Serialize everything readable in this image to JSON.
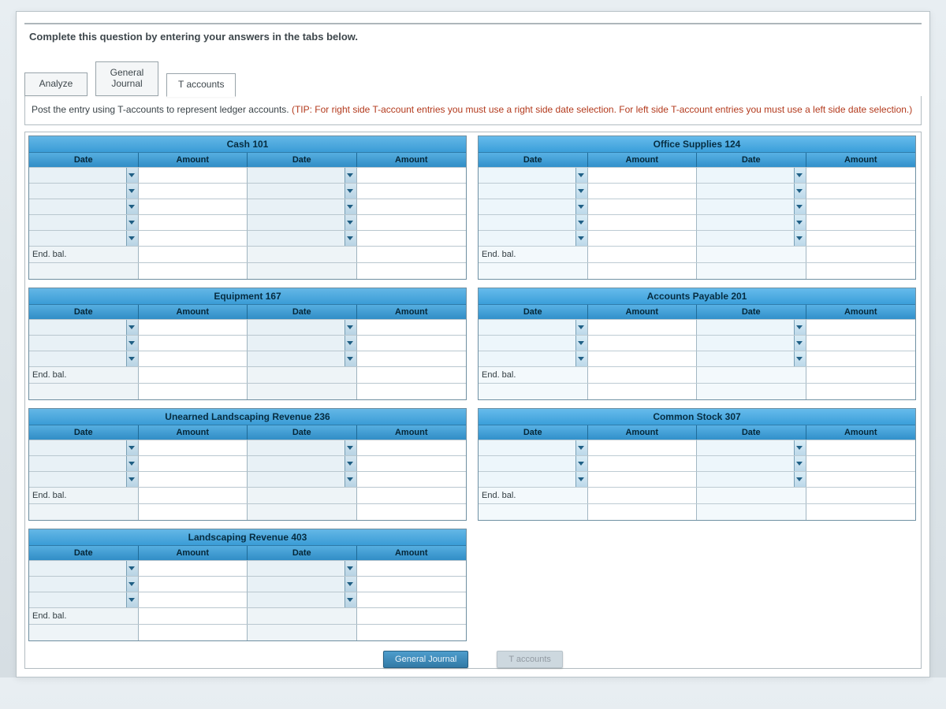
{
  "instruction": "Complete this question by entering your answers in the tabs below.",
  "tabs": [
    {
      "label": "Analyze",
      "active": false
    },
    {
      "label": "General\nJournal",
      "active": false
    },
    {
      "label": "T accounts",
      "active": true
    }
  ],
  "tip": {
    "lead": "Post the entry using T-accounts to represent ledger accounts. ",
    "paren": "(TIP: For right side T-account entries you must use a right side date selection.  For left side T-account entries you must use a left side date selection.)"
  },
  "headers": {
    "date_l": "Date",
    "amount_l": "Amount",
    "date_r": "Date",
    "amount_r": "Amount"
  },
  "end_bal_label": "End. bal.",
  "chart_data": {
    "type": "table",
    "title": "T-accounts (blank worksheet)",
    "accounts": [
      {
        "title": "Cash 101",
        "rows": 5,
        "col": "left"
      },
      {
        "title": "Equipment 167",
        "rows": 3,
        "col": "left"
      },
      {
        "title": "Unearned Landscaping Revenue 236",
        "rows": 3,
        "col": "left"
      },
      {
        "title": "Landscaping Revenue 403",
        "rows": 3,
        "col": "left"
      },
      {
        "title": "Office Supplies 124",
        "rows": 5,
        "col": "right"
      },
      {
        "title": "Accounts Payable 201",
        "rows": 3,
        "col": "right"
      },
      {
        "title": "Common Stock 307",
        "rows": 3,
        "col": "right"
      }
    ]
  },
  "nav": {
    "prev": "General Journal",
    "next": "T accounts"
  }
}
